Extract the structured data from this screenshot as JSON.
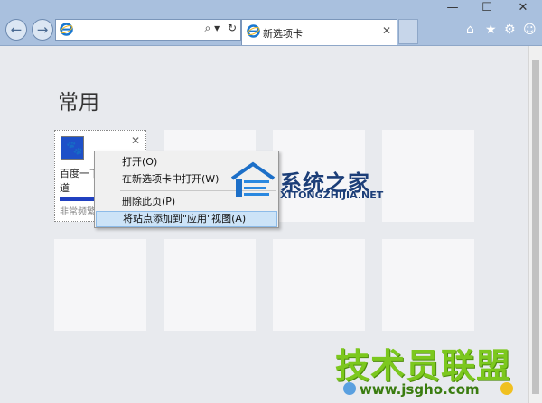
{
  "tab": {
    "title": "新选项卡"
  },
  "toolbar": {
    "search_symbol": "⌕ ▾",
    "refresh_symbol": "↻"
  },
  "window": {
    "minimize": "—",
    "maximize": "☐",
    "close": "✕"
  },
  "page": {
    "heading": "常用",
    "tiles": [
      {
        "name": "百度一下，你就知道",
        "freq_label": "非常频繁",
        "visit_fraction": 1.0
      }
    ]
  },
  "context_menu": {
    "items": [
      {
        "label": "打开(O)"
      },
      {
        "label": "在新选项卡中打开(W)"
      },
      {
        "label": "删除此页(P)"
      },
      {
        "label": "将站点添加到\"应用\"视图(A)"
      }
    ]
  },
  "watermarks": {
    "top_cn": "系统之家",
    "top_en": "XITONGZHIJIA.NET",
    "bottom_cn": "技术员联盟",
    "bottom_url": "www.jsgho.com"
  },
  "colors": {
    "accent": "#1e50c8",
    "chrome": "#a9c0de",
    "highlight": "#cce3f7"
  }
}
